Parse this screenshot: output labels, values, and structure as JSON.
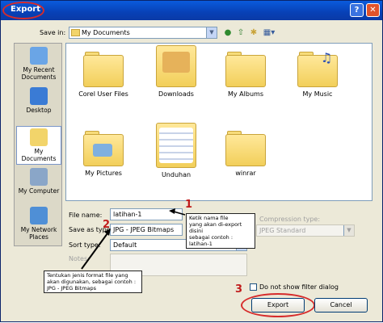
{
  "window": {
    "title": "Export",
    "help_glyph": "?",
    "close_glyph": "✕",
    "accent": "#0a5bdc",
    "annotation_color": "#d62b2b"
  },
  "savein": {
    "label": "Save in:",
    "value": "My Documents"
  },
  "toolbar": {
    "back_icon": "back-arrow-icon",
    "up_icon": "up-folder-icon",
    "new_folder_icon": "new-folder-icon",
    "views_icon": "views-menu-icon"
  },
  "places": [
    {
      "label": "My Recent Documents",
      "icon": "recent-documents-icon"
    },
    {
      "label": "Desktop",
      "icon": "desktop-icon"
    },
    {
      "label": "My Documents",
      "icon": "my-documents-icon"
    },
    {
      "label": "My Computer",
      "icon": "my-computer-icon"
    },
    {
      "label": "My Network Places",
      "icon": "network-places-icon"
    }
  ],
  "files": [
    {
      "name": "Corel User Files"
    },
    {
      "name": "Downloads"
    },
    {
      "name": "My Albums"
    },
    {
      "name": "My Music"
    },
    {
      "name": "My Pictures"
    },
    {
      "name": "Unduhan"
    },
    {
      "name": "winrar"
    }
  ],
  "form": {
    "filename_label": "File name:",
    "filename_value": "latihan-1",
    "saveas_label": "Save as type:",
    "saveas_value": "JPG - JPEG Bitmaps",
    "sort_label": "Sort type:",
    "sort_value": "Default",
    "notes_label": "Notes:",
    "compression_label": "Compression type:",
    "compression_value": "JPEG Standard",
    "noshow_label": "Do not show filter dialog"
  },
  "buttons": {
    "export": "Export",
    "cancel": "Cancel"
  },
  "annotations": {
    "num1": "1",
    "num2": "2",
    "num3": "3",
    "callout1": "Ketik nama file\nyang akan di-export disini\nsebagai contoh : latihan-1",
    "callout2": "Tentukan jenis format file yang\nakan digunakan, sebagai contoh :\nJPG - JPEG Bitmaps"
  }
}
